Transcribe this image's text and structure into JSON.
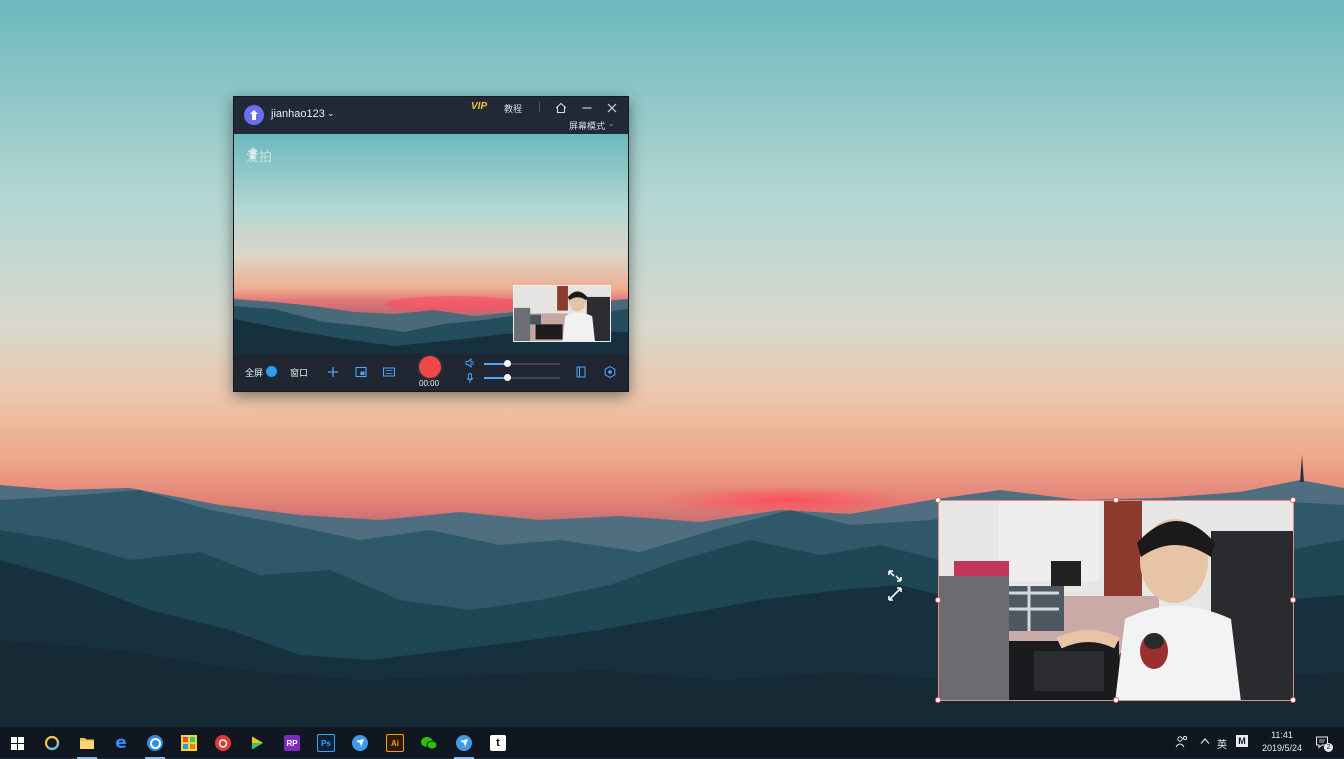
{
  "recorder": {
    "username": "jianhao123",
    "vip_label": "VIP",
    "tutorial_label": "教程",
    "mode_label": "屏幕模式",
    "watermark_text": "爱拍",
    "fullscreen_label": "全屏",
    "window_label": "窗口",
    "timer": "00:00",
    "speaker_volume": 0.3,
    "mic_volume": 0.3,
    "fullscreen_toggle_on": true
  },
  "taskbar": {
    "apps": [
      {
        "name": "start",
        "icon": "windows-start-icon"
      },
      {
        "name": "cortana",
        "icon": "cortana-icon"
      },
      {
        "name": "file-explorer",
        "icon": "folder-icon",
        "running": true
      },
      {
        "name": "edge",
        "icon": "edge-icon"
      },
      {
        "name": "browser",
        "icon": "browser-q-icon",
        "running": true
      },
      {
        "name": "app-grid",
        "icon": "colorful-grid-icon"
      },
      {
        "name": "netease-music",
        "icon": "netease-music-icon"
      },
      {
        "name": "video-player",
        "icon": "play-icon"
      },
      {
        "name": "axure-rp",
        "icon": "rp-icon",
        "label": "RP"
      },
      {
        "name": "photoshop",
        "icon": "ps-icon",
        "label": "Ps"
      },
      {
        "name": "feishu",
        "icon": "bird-icon"
      },
      {
        "name": "illustrator",
        "icon": "ai-icon",
        "label": "Ai"
      },
      {
        "name": "wechat",
        "icon": "wechat-icon"
      },
      {
        "name": "recorder-app",
        "icon": "bird-icon",
        "running": true
      },
      {
        "name": "typora",
        "icon": "t-icon",
        "label": "t"
      }
    ],
    "tray": {
      "ime_lang": "英",
      "ime_mode": "M",
      "time": "11:41",
      "date": "2019/5/24",
      "notifications": "2"
    }
  },
  "colors": {
    "accent": "#2d9bf0",
    "record": "#f04848",
    "vip": "#f5c430",
    "overlay_border": "#e58a8a"
  }
}
